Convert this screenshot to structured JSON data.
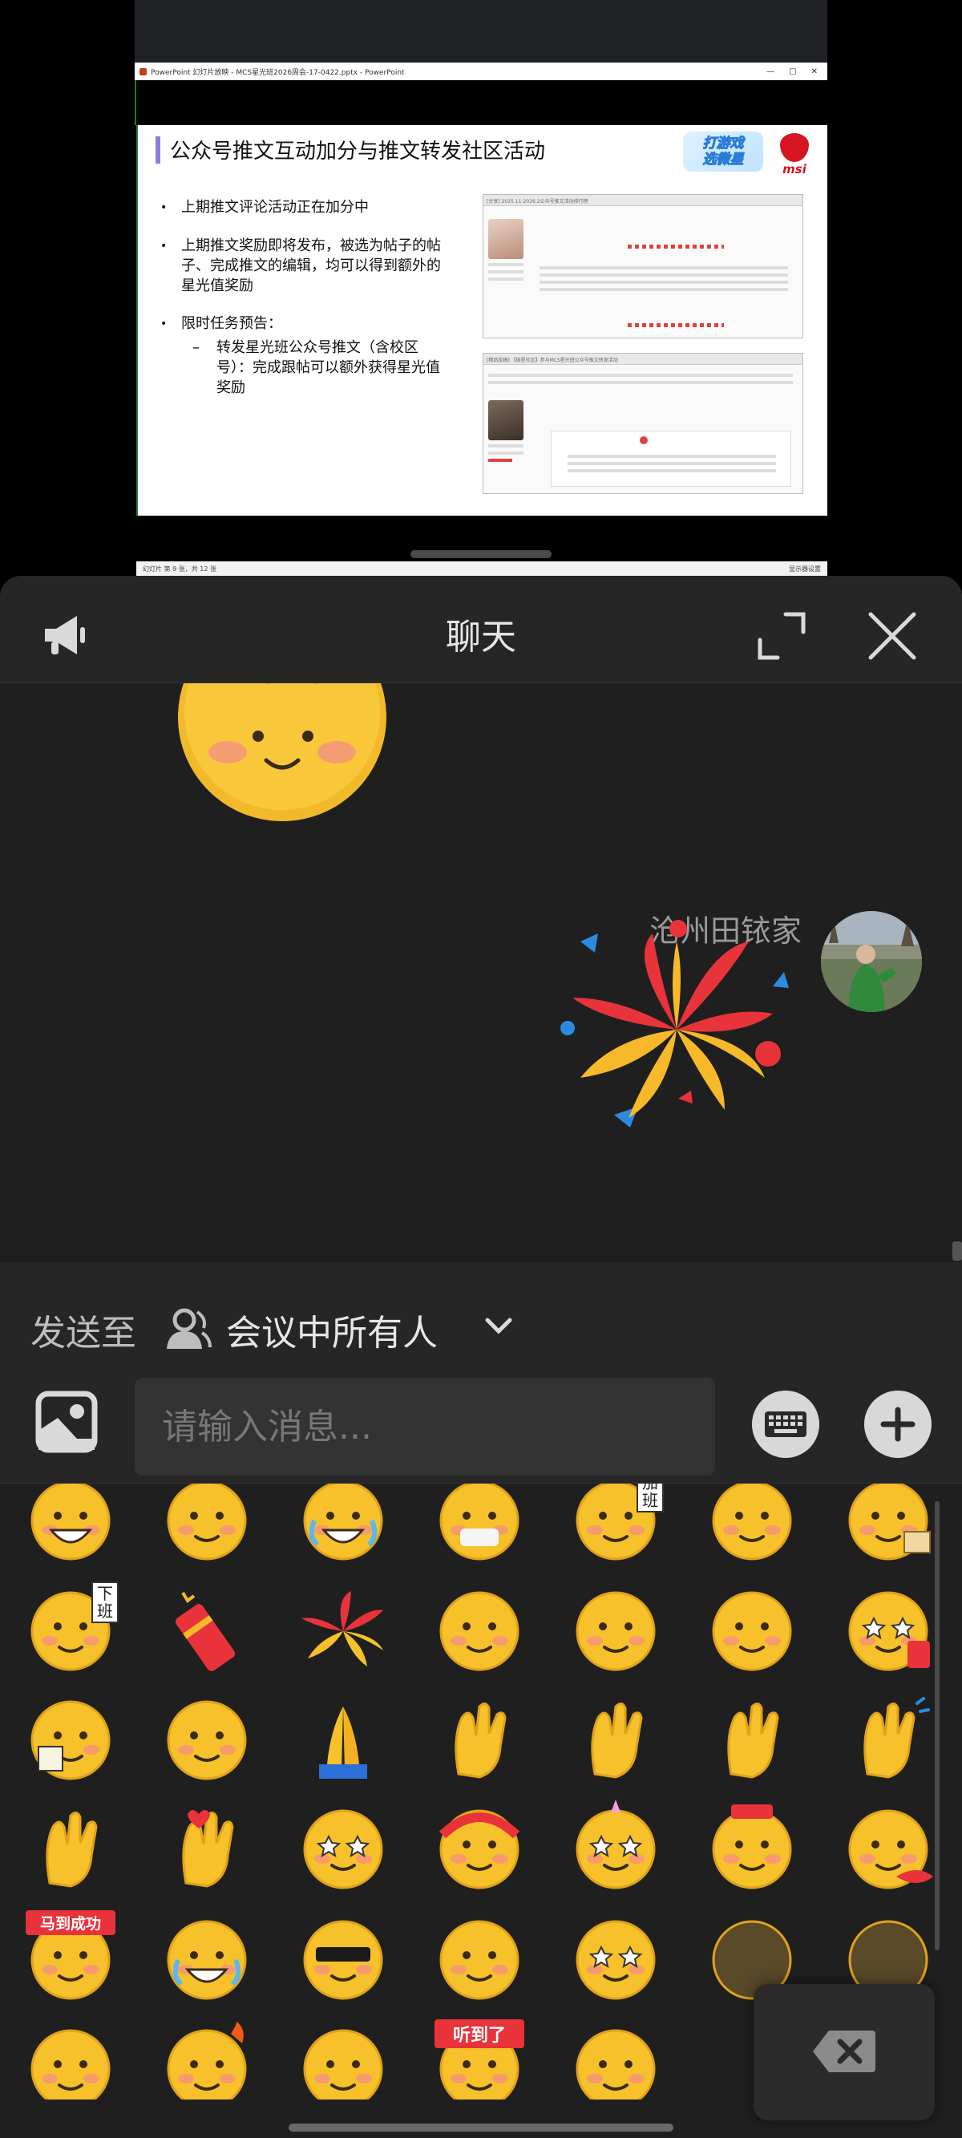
{
  "shared_screen": {
    "window_title": "PowerPoint 幻灯片放映 - MCS星光班2026周会-17-0422.pptx - PowerPoint",
    "window_controls": [
      "—",
      "□",
      "✕"
    ],
    "slide": {
      "title": "公众号推文互动加分与推文转发社区活动",
      "logo_text_line1": "打游戏",
      "logo_text_line2": "选微星",
      "brand": "msi",
      "bullets": [
        {
          "text": "上期推文评论活动正在加分中"
        },
        {
          "text": "上期推文奖励即将发布，被选为帖子的帖子、完成推文的编辑，均可以得到额外的星光值奖励"
        },
        {
          "text": "限时任务预告：",
          "sub": "转发星光班公众号推文（含校区号）：完成跟帖可以额外获得星光值奖励"
        }
      ],
      "forum_post_1_title": "[分享] 2025.11-2026.2公众号推文活动排行榜",
      "forum_post_2_title": "[精品投稿] 【微星社区】参与MCS星光班公众号推文转发活动"
    },
    "status_bar_left": "幻灯片 第 9 张，共 12 张",
    "status_bar_right": "显示器设置"
  },
  "chat": {
    "title": "聊天",
    "sender_name": "沧州田铱家",
    "send_to_label": "发送至",
    "send_to_target": "会议中所有人",
    "input_placeholder": "请输入消息...",
    "sticker_badges": {
      "overtime": "加班",
      "off_work": "下班",
      "success": "马到成功",
      "heard": "听到了"
    }
  },
  "emojis": [
    "grin-emoji",
    "cover-mouth-laugh-emoji",
    "tears-of-joy-emoji",
    "mask-emoji",
    "overtime-emoji",
    "pat-head-emoji",
    "tired-book-emoji",
    "off-work-emoji",
    "firecracker-emoji",
    "fireworks-emoji",
    "facepalm-emoji",
    "head-pain-emoji",
    "shy-emoji",
    "starry-eyes-redpacket-emoji",
    "read-note-emoji",
    "sparkle-emoji",
    "pray-emoji",
    "raised-hand-emoji",
    "thumbs-up-emoji",
    "ok-hand-emoji",
    "clap-emoji",
    "handshake-emoji",
    "finger-heart-emoji",
    "gold-ingot-emoji",
    "lion-dance-emoji",
    "unicorn-emoji",
    "fortune-god-emoji",
    "fish-emoji",
    "success-banner-emoji",
    "crying-emoji",
    "cool-sunglasses-emoji",
    "smirk-emoji",
    "excited-emoji",
    "tea-emoji",
    "flushed-emoji",
    "wink-emoji",
    "angry-fire-emoji",
    "peek-emoji",
    "heard-banner-emoji",
    "yellow-black-emoji"
  ],
  "colors": {
    "panel_bg": "#1f1f1f",
    "header_bg": "#262626",
    "emoji_yellow": "#f7c12b",
    "emoji_red": "#e8333a"
  }
}
